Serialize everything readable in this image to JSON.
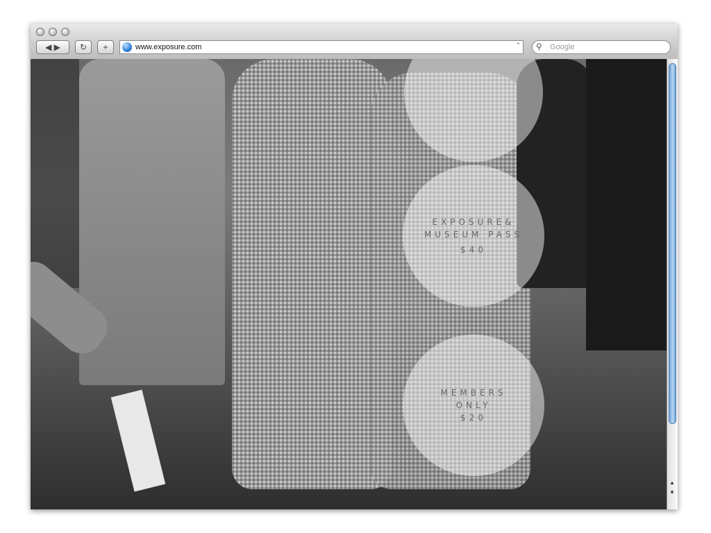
{
  "browser": {
    "address": "www.exposure.com",
    "search_placeholder": "Google",
    "back_label": "◀",
    "forward_label": "▶",
    "reload_label": "↻",
    "add_label": "+"
  },
  "circles": {
    "top": {
      "lines": []
    },
    "pass": {
      "lines": [
        "EXPOSURE&",
        "MUSEUM PASS",
        "$40"
      ]
    },
    "members": {
      "lines": [
        "MEMBERS",
        "ONLY",
        "$20"
      ]
    }
  },
  "colors": {
    "toolbar": "#d0d0d0",
    "circle_text": "#666666",
    "scroll_thumb": "#8fb8e6"
  }
}
